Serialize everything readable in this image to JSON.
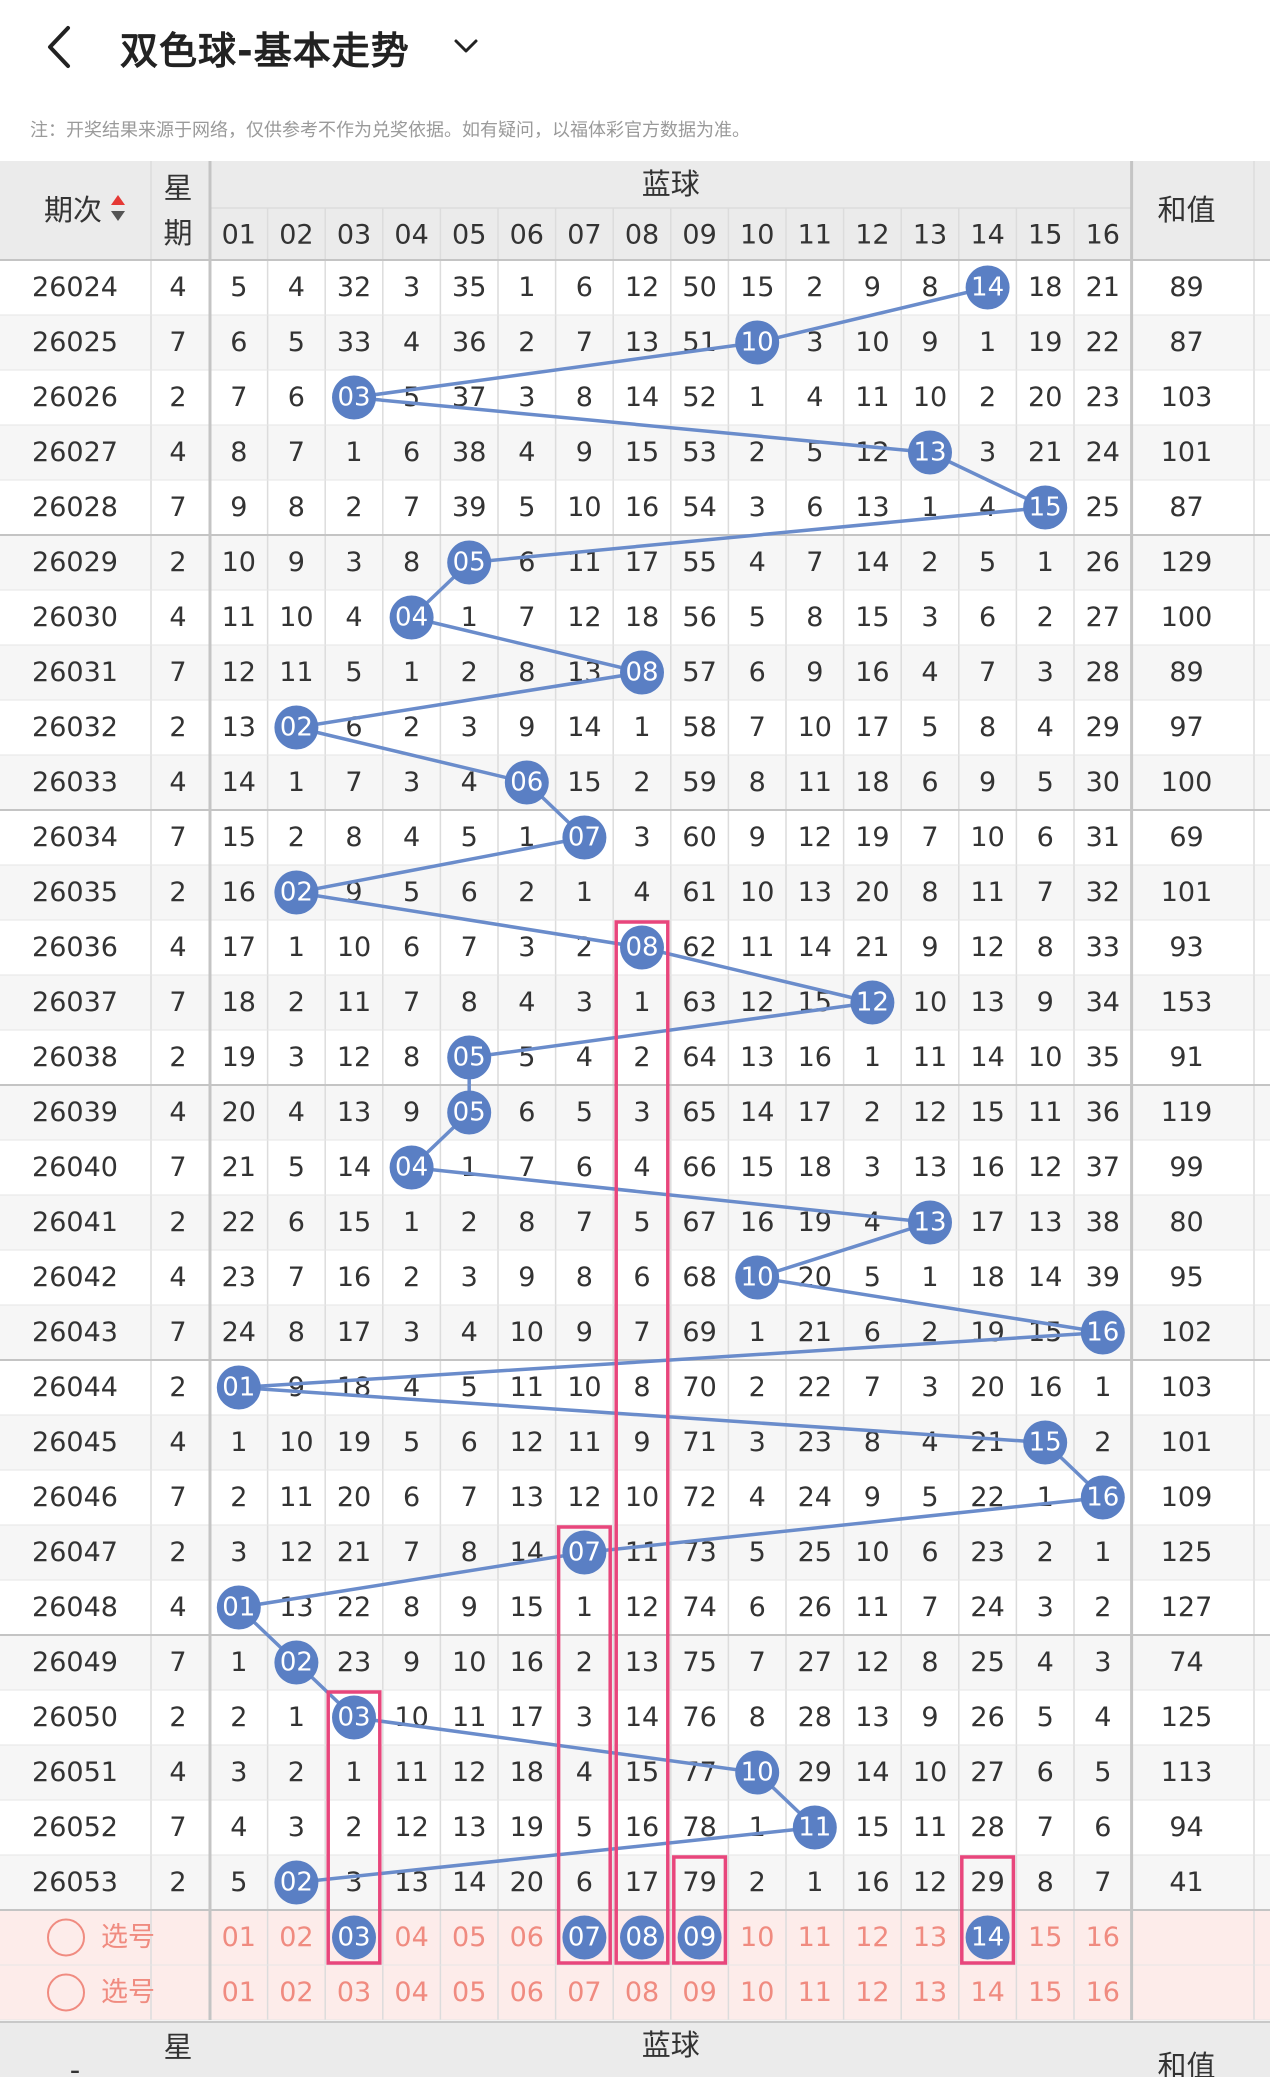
{
  "header": {
    "title": "双色球-基本走势",
    "back_icon": "chevron-left-icon",
    "dropdown_icon": "chevron-down-icon"
  },
  "notice": "注：开奖结果来源于网络，仅供参考不作为兑奖依据。如有疑问，以福体彩官方数据为准。",
  "table": {
    "col_period": "期次",
    "col_week": "星期",
    "col_blue": "蓝球",
    "col_sum": "和值",
    "blue_numbers": [
      "01",
      "02",
      "03",
      "04",
      "05",
      "06",
      "07",
      "08",
      "09",
      "10",
      "11",
      "12",
      "13",
      "14",
      "15",
      "16"
    ],
    "rows": [
      {
        "period": "26024",
        "week": "4",
        "hit": 14,
        "cells": [
          "5",
          "4",
          "32",
          "3",
          "35",
          "1",
          "6",
          "12",
          "50",
          "15",
          "2",
          "9",
          "8",
          "14",
          "18",
          "21"
        ],
        "sum": "89"
      },
      {
        "period": "26025",
        "week": "7",
        "hit": 10,
        "cells": [
          "6",
          "5",
          "33",
          "4",
          "36",
          "2",
          "7",
          "13",
          "51",
          "10",
          "3",
          "10",
          "9",
          "1",
          "19",
          "22"
        ],
        "sum": "87"
      },
      {
        "period": "26026",
        "week": "2",
        "hit": 3,
        "cells": [
          "7",
          "6",
          "03",
          "5",
          "37",
          "3",
          "8",
          "14",
          "52",
          "1",
          "4",
          "11",
          "10",
          "2",
          "20",
          "23"
        ],
        "sum": "103"
      },
      {
        "period": "26027",
        "week": "4",
        "hit": 13,
        "cells": [
          "8",
          "7",
          "1",
          "6",
          "38",
          "4",
          "9",
          "15",
          "53",
          "2",
          "5",
          "12",
          "13",
          "3",
          "21",
          "24"
        ],
        "sum": "101"
      },
      {
        "period": "26028",
        "week": "7",
        "hit": 15,
        "cells": [
          "9",
          "8",
          "2",
          "7",
          "39",
          "5",
          "10",
          "16",
          "54",
          "3",
          "6",
          "13",
          "1",
          "4",
          "15",
          "25"
        ],
        "sum": "87"
      },
      {
        "period": "26029",
        "week": "2",
        "hit": 5,
        "cells": [
          "10",
          "9",
          "3",
          "8",
          "05",
          "6",
          "11",
          "17",
          "55",
          "4",
          "7",
          "14",
          "2",
          "5",
          "1",
          "26"
        ],
        "sum": "129"
      },
      {
        "period": "26030",
        "week": "4",
        "hit": 4,
        "cells": [
          "11",
          "10",
          "4",
          "04",
          "1",
          "7",
          "12",
          "18",
          "56",
          "5",
          "8",
          "15",
          "3",
          "6",
          "2",
          "27"
        ],
        "sum": "100"
      },
      {
        "period": "26031",
        "week": "7",
        "hit": 8,
        "cells": [
          "12",
          "11",
          "5",
          "1",
          "2",
          "8",
          "13",
          "08",
          "57",
          "6",
          "9",
          "16",
          "4",
          "7",
          "3",
          "28"
        ],
        "sum": "89"
      },
      {
        "period": "26032",
        "week": "2",
        "hit": 2,
        "cells": [
          "13",
          "02",
          "6",
          "2",
          "3",
          "9",
          "14",
          "1",
          "58",
          "7",
          "10",
          "17",
          "5",
          "8",
          "4",
          "29"
        ],
        "sum": "97"
      },
      {
        "period": "26033",
        "week": "4",
        "hit": 6,
        "cells": [
          "14",
          "1",
          "7",
          "3",
          "4",
          "06",
          "15",
          "2",
          "59",
          "8",
          "11",
          "18",
          "6",
          "9",
          "5",
          "30"
        ],
        "sum": "100"
      },
      {
        "period": "26034",
        "week": "7",
        "hit": 7,
        "cells": [
          "15",
          "2",
          "8",
          "4",
          "5",
          "1",
          "07",
          "3",
          "60",
          "9",
          "12",
          "19",
          "7",
          "10",
          "6",
          "31"
        ],
        "sum": "69"
      },
      {
        "period": "26035",
        "week": "2",
        "hit": 2,
        "cells": [
          "16",
          "02",
          "9",
          "5",
          "6",
          "2",
          "1",
          "4",
          "61",
          "10",
          "13",
          "20",
          "8",
          "11",
          "7",
          "32"
        ],
        "sum": "101"
      },
      {
        "period": "26036",
        "week": "4",
        "hit": 8,
        "cells": [
          "17",
          "1",
          "10",
          "6",
          "7",
          "3",
          "2",
          "08",
          "62",
          "11",
          "14",
          "21",
          "9",
          "12",
          "8",
          "33"
        ],
        "sum": "93"
      },
      {
        "period": "26037",
        "week": "7",
        "hit": 12,
        "cells": [
          "18",
          "2",
          "11",
          "7",
          "8",
          "4",
          "3",
          "1",
          "63",
          "12",
          "15",
          "12",
          "10",
          "13",
          "9",
          "34"
        ],
        "sum": "153"
      },
      {
        "period": "26038",
        "week": "2",
        "hit": 5,
        "cells": [
          "19",
          "3",
          "12",
          "8",
          "05",
          "5",
          "4",
          "2",
          "64",
          "13",
          "16",
          "1",
          "11",
          "14",
          "10",
          "35"
        ],
        "sum": "91"
      },
      {
        "period": "26039",
        "week": "4",
        "hit": 5,
        "cells": [
          "20",
          "4",
          "13",
          "9",
          "05",
          "6",
          "5",
          "3",
          "65",
          "14",
          "17",
          "2",
          "12",
          "15",
          "11",
          "36"
        ],
        "sum": "119"
      },
      {
        "period": "26040",
        "week": "7",
        "hit": 4,
        "cells": [
          "21",
          "5",
          "14",
          "04",
          "1",
          "7",
          "6",
          "4",
          "66",
          "15",
          "18",
          "3",
          "13",
          "16",
          "12",
          "37"
        ],
        "sum": "99"
      },
      {
        "period": "26041",
        "week": "2",
        "hit": 13,
        "cells": [
          "22",
          "6",
          "15",
          "1",
          "2",
          "8",
          "7",
          "5",
          "67",
          "16",
          "19",
          "4",
          "13",
          "17",
          "13",
          "38"
        ],
        "sum": "80"
      },
      {
        "period": "26042",
        "week": "4",
        "hit": 10,
        "cells": [
          "23",
          "7",
          "16",
          "2",
          "3",
          "9",
          "8",
          "6",
          "68",
          "10",
          "20",
          "5",
          "1",
          "18",
          "14",
          "39"
        ],
        "sum": "95"
      },
      {
        "period": "26043",
        "week": "7",
        "hit": 16,
        "cells": [
          "24",
          "8",
          "17",
          "3",
          "4",
          "10",
          "9",
          "7",
          "69",
          "1",
          "21",
          "6",
          "2",
          "19",
          "15",
          "16"
        ],
        "sum": "102"
      },
      {
        "period": "26044",
        "week": "2",
        "hit": 1,
        "cells": [
          "01",
          "9",
          "18",
          "4",
          "5",
          "11",
          "10",
          "8",
          "70",
          "2",
          "22",
          "7",
          "3",
          "20",
          "16",
          "1"
        ],
        "sum": "103"
      },
      {
        "period": "26045",
        "week": "4",
        "hit": 15,
        "cells": [
          "1",
          "10",
          "19",
          "5",
          "6",
          "12",
          "11",
          "9",
          "71",
          "3",
          "23",
          "8",
          "4",
          "21",
          "15",
          "2"
        ],
        "sum": "101"
      },
      {
        "period": "26046",
        "week": "7",
        "hit": 16,
        "cells": [
          "2",
          "11",
          "20",
          "6",
          "7",
          "13",
          "12",
          "10",
          "72",
          "4",
          "24",
          "9",
          "5",
          "22",
          "1",
          "16"
        ],
        "sum": "109"
      },
      {
        "period": "26047",
        "week": "2",
        "hit": 7,
        "cells": [
          "3",
          "12",
          "21",
          "7",
          "8",
          "14",
          "07",
          "11",
          "73",
          "5",
          "25",
          "10",
          "6",
          "23",
          "2",
          "1"
        ],
        "sum": "125"
      },
      {
        "period": "26048",
        "week": "4",
        "hit": 1,
        "cells": [
          "01",
          "13",
          "22",
          "8",
          "9",
          "15",
          "1",
          "12",
          "74",
          "6",
          "26",
          "11",
          "7",
          "24",
          "3",
          "2"
        ],
        "sum": "127"
      },
      {
        "period": "26049",
        "week": "7",
        "hit": 2,
        "cells": [
          "1",
          "02",
          "23",
          "9",
          "10",
          "16",
          "2",
          "13",
          "75",
          "7",
          "27",
          "12",
          "8",
          "25",
          "4",
          "3"
        ],
        "sum": "74"
      },
      {
        "period": "26050",
        "week": "2",
        "hit": 3,
        "cells": [
          "2",
          "1",
          "03",
          "10",
          "11",
          "17",
          "3",
          "14",
          "76",
          "8",
          "28",
          "13",
          "9",
          "26",
          "5",
          "4"
        ],
        "sum": "125"
      },
      {
        "period": "26051",
        "week": "4",
        "hit": 10,
        "cells": [
          "3",
          "2",
          "1",
          "11",
          "12",
          "18",
          "4",
          "15",
          "77",
          "10",
          "29",
          "14",
          "10",
          "27",
          "6",
          "5"
        ],
        "sum": "113"
      },
      {
        "period": "26052",
        "week": "7",
        "hit": 11,
        "cells": [
          "4",
          "3",
          "2",
          "12",
          "13",
          "19",
          "5",
          "16",
          "78",
          "1",
          "11",
          "15",
          "11",
          "28",
          "7",
          "6"
        ],
        "sum": "94"
      },
      {
        "period": "26053",
        "week": "2",
        "hit": 2,
        "cells": [
          "5",
          "02",
          "3",
          "13",
          "14",
          "20",
          "6",
          "17",
          "79",
          "2",
          "1",
          "16",
          "12",
          "29",
          "8",
          "7"
        ],
        "sum": "41"
      }
    ],
    "select_rows": [
      {
        "label": "选号",
        "selected": [
          3,
          7,
          8,
          9,
          14
        ]
      },
      {
        "label": "选号",
        "selected": []
      }
    ],
    "footer_week_partial": "星",
    "footer_period_partial": "-",
    "highlight_boxes": [
      {
        "col": 8,
        "from": "26036",
        "to": "选号1"
      },
      {
        "col": 7,
        "from": "26047",
        "to": "选号1"
      },
      {
        "col": 3,
        "from": "26050",
        "to": "选号1"
      },
      {
        "col": 9,
        "from": "26053",
        "to": "选号1"
      },
      {
        "col": 14,
        "from": "26053",
        "to": "选号1"
      }
    ]
  },
  "colors": {
    "ball": "#5a7fc4",
    "line": "#6a8ccb",
    "highlight": "#e8467c",
    "header_bg": "#ebebeb",
    "select_bg": "#fdecea",
    "select_text": "#f08b80"
  }
}
